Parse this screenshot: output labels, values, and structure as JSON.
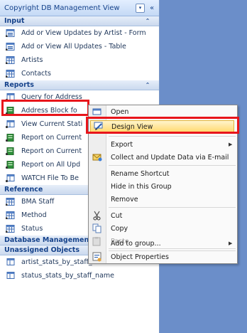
{
  "nav": {
    "title": "Copyright DB Management View",
    "dropdown_glyph": "▾",
    "collapse_glyph": "«",
    "groups": [
      {
        "label": "Input",
        "caret": "⌃",
        "items": [
          {
            "label": "Add or View Updates by Artist - Form",
            "icon": "form-icon"
          },
          {
            "label": "Add or View All Updates - Table",
            "icon": "form-icon"
          },
          {
            "label": "Artists",
            "icon": "table-icon"
          },
          {
            "label": "Contacts",
            "icon": "table-icon"
          }
        ]
      },
      {
        "label": "Reports",
        "caret": "⌃",
        "items": [
          {
            "label": "Query for Address",
            "icon": "query-icon"
          },
          {
            "label": "Address Block fo",
            "icon": "report-icon"
          },
          {
            "label": "View Current Stati",
            "icon": "query-icon"
          },
          {
            "label": "Report on Current",
            "icon": "report-icon"
          },
          {
            "label": "Report on Current",
            "icon": "report-icon"
          },
          {
            "label": "Report on All Upd",
            "icon": "report-icon"
          },
          {
            "label": "WATCH File To Be",
            "icon": "query-icon"
          }
        ]
      },
      {
        "label": "Reference",
        "caret": "",
        "items": [
          {
            "label": "BMA Staff",
            "icon": "table-icon"
          },
          {
            "label": "Method",
            "icon": "table-icon"
          },
          {
            "label": "Status",
            "icon": "table-icon"
          }
        ]
      },
      {
        "label": "Database Managemen",
        "caret": "",
        "items": []
      },
      {
        "label": "Unassigned Objects",
        "caret": "⌃",
        "items": [
          {
            "label": "artist_stats_by_staff_name",
            "icon": "query-icon"
          },
          {
            "label": "status_stats_by_staff_name",
            "icon": "query-icon"
          }
        ]
      }
    ]
  },
  "context_menu": {
    "items": [
      {
        "label": "Open",
        "icon": "open-icon"
      },
      {
        "label": "Design View",
        "icon": "design-view-icon",
        "highlighted": true
      },
      {
        "label": "Export",
        "icon": "",
        "submenu": true
      },
      {
        "label": "Collect and Update Data via E-mail",
        "icon": "email-icon"
      },
      {
        "label": "Rename Shortcut",
        "icon": ""
      },
      {
        "label": "Hide in this Group",
        "icon": ""
      },
      {
        "label": "Remove",
        "icon": ""
      },
      {
        "label": "Cut",
        "icon": "scissors-icon"
      },
      {
        "label": "Copy",
        "icon": "copy-icon"
      },
      {
        "label": "Paste",
        "icon": "paste-icon",
        "disabled": true
      },
      {
        "label": "Add to group...",
        "icon": "",
        "submenu": true
      },
      {
        "label": "Object Properties",
        "icon": "properties-icon"
      }
    ]
  },
  "colors": {
    "background": "#6b8ec9",
    "highlight_outline": "#e8151b",
    "menu_highlight": "#ffd86c"
  }
}
